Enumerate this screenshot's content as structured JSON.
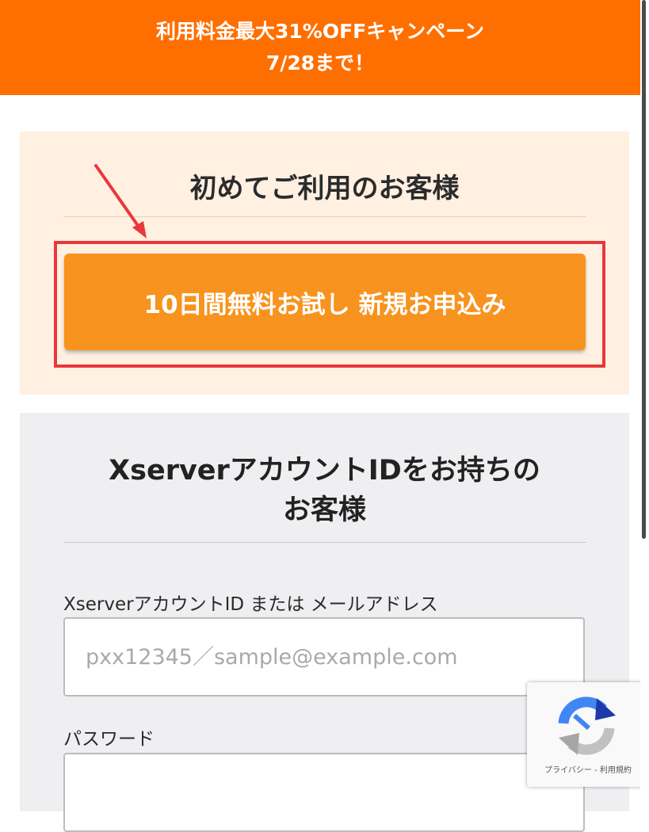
{
  "banner": {
    "line1": "利用料金最大31%OFFキャンペーン",
    "line2": "7/28まで！",
    "color": "#ff6f00"
  },
  "newcomer": {
    "title": "初めてご利用のお客様",
    "signup_button": "10日間無料お試し 新規お申込み",
    "button_color": "#f7931e",
    "highlight_color": "#e8383d"
  },
  "login": {
    "title_line1": "XserverアカウントIDをお持ちの",
    "title_line2": "お客様",
    "id_label": "XserverアカウントID または メールアドレス",
    "id_placeholder": "pxx12345／sample@example.com",
    "password_label": "パスワード"
  },
  "recaptcha": {
    "links": "プライバシー - 利用規約",
    "icon": "recaptcha-icon"
  }
}
